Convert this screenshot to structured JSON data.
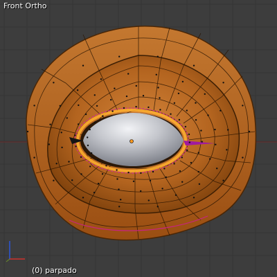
{
  "viewport": {
    "view_name": "Front Ortho",
    "object_info": "(0) parpado",
    "background_color": "#3d3d3d",
    "grid_color": "#353535",
    "mesh_color": "#b8651e",
    "eyeball_color": "#b4b6bc",
    "seam_color": "#ff00ff",
    "axis_x_color": "#d0312d",
    "axis_z_color": "#2d57d8",
    "object_name": "parpado"
  }
}
